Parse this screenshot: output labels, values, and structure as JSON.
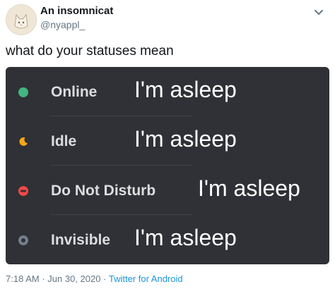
{
  "tweet": {
    "display_name": "An insomnicat",
    "handle": "@nyappl_",
    "text": "what do your statuses mean",
    "time": "7:18 AM",
    "separator": "·",
    "date": "Jun 30, 2020",
    "source": "Twitter for Android"
  },
  "status_menu": {
    "items": [
      {
        "label": "Online",
        "meaning": "I'm asleep",
        "icon": "online-dot-icon",
        "color": "#43b581"
      },
      {
        "label": "Idle",
        "meaning": "I'm asleep",
        "icon": "idle-moon-icon",
        "color": "#faa61a"
      },
      {
        "label": "Do Not Disturb",
        "meaning": "I'm asleep",
        "icon": "dnd-icon",
        "color": "#f04747"
      },
      {
        "label": "Invisible",
        "meaning": "I'm asleep",
        "icon": "invisible-ring-icon",
        "color": "#747f8d"
      }
    ]
  },
  "colors": {
    "card_background": "#2f3136",
    "link": "#1b95e0",
    "muted_text": "#657786"
  }
}
